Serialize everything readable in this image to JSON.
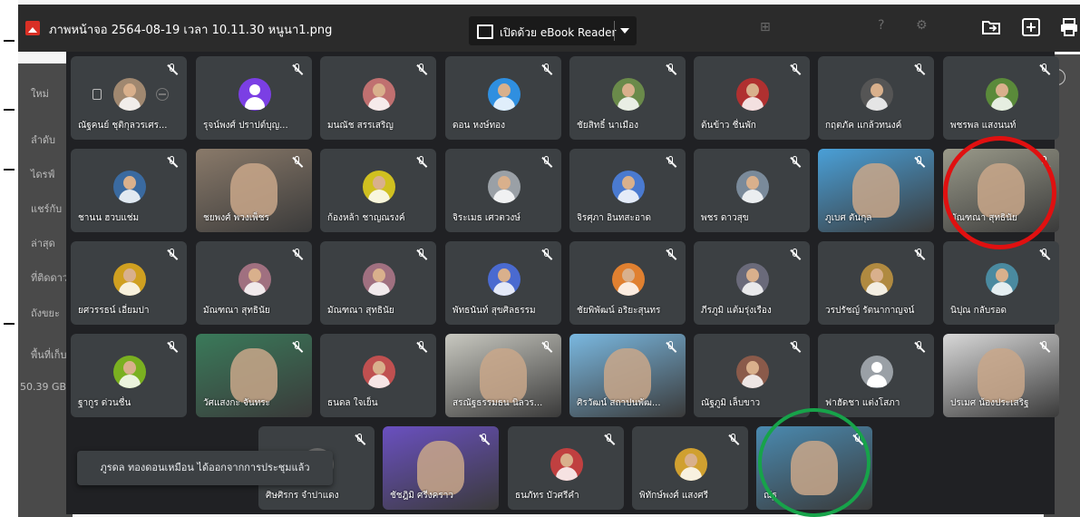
{
  "viewer": {
    "file_name": "ภาพหน้าจอ 2564-08-19 เวลา 10.11.30 หนูนา1.png",
    "open_with_label": "เปิดด้วย eBook Reader",
    "icons": [
      "image-file-icon",
      "open-with-icon",
      "caret-down-icon",
      "add-to-folder-icon",
      "add-icon",
      "print-icon"
    ]
  },
  "background": {
    "sidebar_labels": [
      "ใหม่",
      "ลำดับ",
      "ไดรฟ์",
      "แชร์กับ",
      "ล่าสุด",
      "ที่ติดดาว",
      "ถังขยะ",
      "พื้นที่เก็บ",
      "50.39 GB"
    ],
    "colors": {
      "page": "#f5f5f5",
      "sidebar": "#4a4a4a"
    }
  },
  "meeting": {
    "background_color": "#202124",
    "tile_color": "#3c4043",
    "rows": [
      {
        "tiles": [
          {
            "name": "ณัฐคนย์ ชุติกุลวรเศร...",
            "kind": "avatar-photo",
            "icons": [
              "pin-icon",
              "remove-icon"
            ],
            "color": "#a08870"
          },
          {
            "name": "รุจน์พงศ์ ปราปต์บุญ...",
            "kind": "initial-avatar",
            "color": "#7b3fe4"
          },
          {
            "name": "มนณัช สรรเสริญ",
            "kind": "avatar-photo",
            "color": "#c07070"
          },
          {
            "name": "ดอน หงษ์ทอง",
            "kind": "avatar-photo",
            "color": "#2f8fe0"
          },
          {
            "name": "ชัยสิทธิ์ นาเมือง",
            "kind": "avatar-photo",
            "color": "#6a8a4a"
          },
          {
            "name": "ต้นข้าว ชื่นพัก",
            "kind": "avatar-photo",
            "color": "#b03030"
          },
          {
            "name": "กฤตภัค แกล้วทนงค์",
            "kind": "avatar-photo",
            "color": "#555555"
          },
          {
            "name": "พชรพล แสงนนท์",
            "kind": "avatar-photo",
            "color": "#5a8a3a"
          }
        ]
      },
      {
        "tiles": [
          {
            "name": "ชานน ฮวบแช่ม",
            "kind": "avatar-photo",
            "color": "#3a6aa0"
          },
          {
            "name": "ชยพงศ์ พวงเพ็ชร",
            "kind": "video",
            "color": "#8a7a6a"
          },
          {
            "name": "ก้องหล้า ชาญณรงค์",
            "kind": "avatar-photo",
            "color": "#d0c020"
          },
          {
            "name": "จิระเมธ เศวตวงษ์",
            "kind": "avatar-photo",
            "color": "#9aa0a6"
          },
          {
            "name": "จิรศุภา อินทสะอาด",
            "kind": "avatar-photo",
            "color": "#4a7ad0"
          },
          {
            "name": "พชร ดาวสุข",
            "kind": "avatar-photo",
            "color": "#7a8a9a"
          },
          {
            "name": "ภูเบศ ตันกุล",
            "kind": "video",
            "color": "#4aa0d8"
          },
          {
            "name": "มัณฑณา สุทธินัย",
            "kind": "video",
            "color": "#9a9a8a",
            "highlighted": true
          }
        ]
      },
      {
        "tiles": [
          {
            "name": "ยศวรรธน์ เอี่ยมปา",
            "kind": "avatar-photo",
            "color": "#d0a020"
          },
          {
            "name": "มัณฑณา สุทธินัย",
            "kind": "avatar-photo",
            "color": "#a07080"
          },
          {
            "name": "มัณฑณา สุทธินัย",
            "kind": "avatar-photo",
            "color": "#a07080"
          },
          {
            "name": "พัทธนันท์ สุขศิลธรรม",
            "kind": "avatar-photo",
            "color": "#4a6ad0"
          },
          {
            "name": "ชัยพิพัฒน์ อริยะสุนทร",
            "kind": "avatar-photo",
            "color": "#e08030"
          },
          {
            "name": "ภีรภูมิ แต้มรุ่งเรือง",
            "kind": "avatar-photo",
            "color": "#6a6a7a"
          },
          {
            "name": "วรปรัชญ์ รัตนากาญจน์",
            "kind": "avatar-photo",
            "color": "#b08a40"
          },
          {
            "name": "นิปุณ กลับรอด",
            "kind": "avatar-photo",
            "color": "#4a8aa0"
          }
        ]
      },
      {
        "tiles": [
          {
            "name": "ฐากูร ด่วนชื่น",
            "kind": "avatar-photo",
            "color": "#7ab020"
          },
          {
            "name": "วัศแสงกะ จันทระ",
            "kind": "video",
            "color": "#3a7a5a"
          },
          {
            "name": "ธนดล ใจเย็น",
            "kind": "avatar-photo",
            "color": "#c05050"
          },
          {
            "name": "สรณัฐธรรมธน นิลวร...",
            "kind": "video",
            "color": "#c8c8c0"
          },
          {
            "name": "ศิรวัฒน์ สถาปนพัฒ...",
            "kind": "video",
            "color": "#7ab8e0"
          },
          {
            "name": "ณัฐภูมิ เล็บขาว",
            "kind": "avatar-photo",
            "color": "#8a5a4a"
          },
          {
            "name": "ฟาฮัดชา แต่งโสภา",
            "kind": "initial-avatar",
            "color": "#9aa0a6"
          },
          {
            "name": "ปรเมศ น้องประเสริฐ",
            "kind": "video",
            "color": "#d8d8d8"
          }
        ]
      },
      {
        "tiles": [
          {
            "name": "ศิษศิรกร จำปาแดง",
            "kind": "avatar-photo",
            "color": "#6a6a6a"
          },
          {
            "name": "ชัชฎิมิ ศรีงคราว",
            "kind": "video",
            "color": "#6a50c0"
          },
          {
            "name": "ธนภัทร บัวศรีคำ",
            "kind": "avatar-photo",
            "color": "#c04040"
          },
          {
            "name": "พิทักษ์พงศ์ แสงศรี",
            "kind": "avatar-photo",
            "color": "#d0a030"
          },
          {
            "name": "ณัฐ",
            "kind": "video",
            "color": "#4a8ab0",
            "highlighted": true
          }
        ]
      }
    ],
    "toast": "ภูรดล ทองดอนเหมือน ได้ออกจากการประชุมแล้ว"
  },
  "annotations": {
    "red_circle_color": "#e01010",
    "green_circle_color": "#17a34a"
  }
}
